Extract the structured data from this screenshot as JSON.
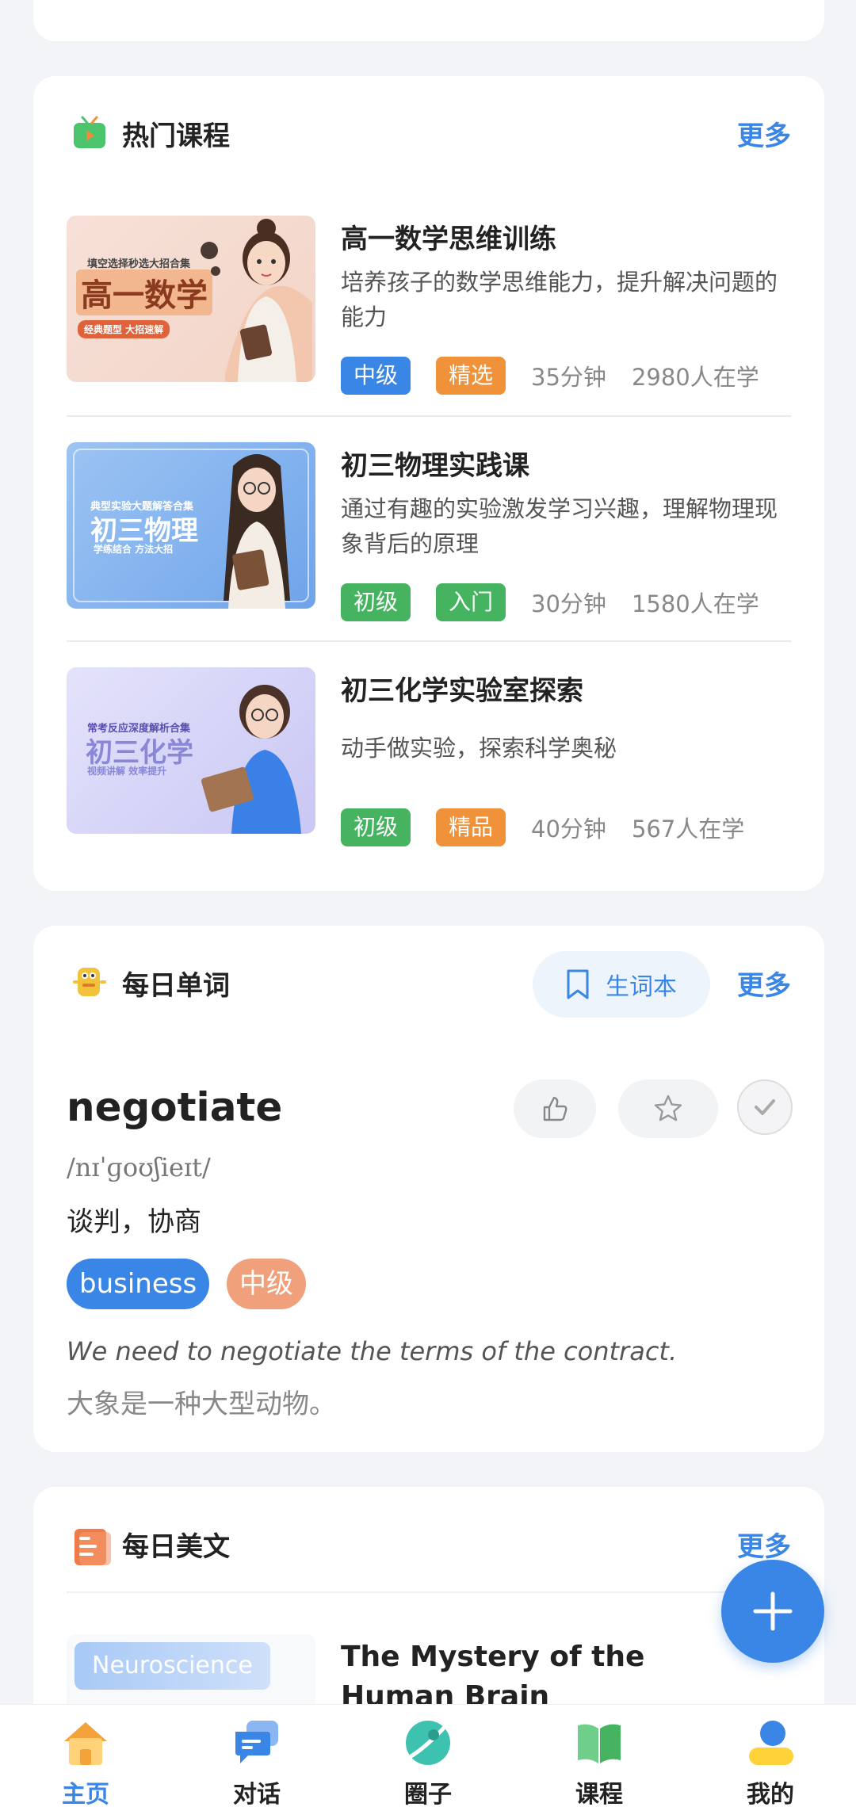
{
  "sections": {
    "courses": {
      "title": "热门课程",
      "more": "更多",
      "items": [
        {
          "title": "高一数学思维训练",
          "desc": "培养孩子的数学思维能力，提升解决问题的能力",
          "level": "中级",
          "badge": "精选",
          "duration": "35分钟",
          "learners": "2980人在学",
          "thumb": {
            "line": "填空选择秒选大招合集",
            "big": "高一数学",
            "sub": "经典题型  大招速解"
          }
        },
        {
          "title": "初三物理实践课",
          "desc": "通过有趣的实验激发学习兴趣，理解物理现象背后的原理",
          "level": "初级",
          "badge": "入门",
          "duration": "30分钟",
          "learners": "1580人在学",
          "thumb": {
            "line": "典型实验大题解答合集",
            "big": "初三物理",
            "sub": "学练结合  方法大招"
          }
        },
        {
          "title": "初三化学实验室探索",
          "desc": "动手做实验，探索科学奥秘",
          "level": "初级",
          "badge": "精品",
          "duration": "40分钟",
          "learners": "567人在学",
          "thumb": {
            "line": "常考反应深度解析合集",
            "big": "初三化学",
            "sub": "视频讲解  效率提升"
          }
        }
      ]
    },
    "words": {
      "title": "每日单词",
      "vocab_label": "生词本",
      "more": "更多",
      "word": "negotiate",
      "phonetic": "/nɪˈɡoʊʃieɪt/",
      "meaning": "谈判，协商",
      "tag_category": "business",
      "tag_level": "中级",
      "example": "We need to negotiate the terms of the contract.",
      "translation": "大象是一种大型动物。"
    },
    "articles": {
      "title": "每日美文",
      "more": "更多",
      "item_tag": "Neuroscience",
      "item_title": "The Mystery of the Human Brain"
    }
  },
  "tabbar": {
    "items": [
      {
        "label": "主页",
        "icon": "home-icon",
        "active": true
      },
      {
        "label": "对话",
        "icon": "chat-icon",
        "active": false
      },
      {
        "label": "圈子",
        "icon": "planet-icon",
        "active": false
      },
      {
        "label": "课程",
        "icon": "book-icon",
        "active": false
      },
      {
        "label": "我的",
        "icon": "profile-icon",
        "active": false
      }
    ]
  },
  "colors": {
    "accent": "#3a86e6",
    "orange_tag": "#f0923a",
    "green_tag": "#45b35f",
    "level_pill": "#f0a07a"
  }
}
